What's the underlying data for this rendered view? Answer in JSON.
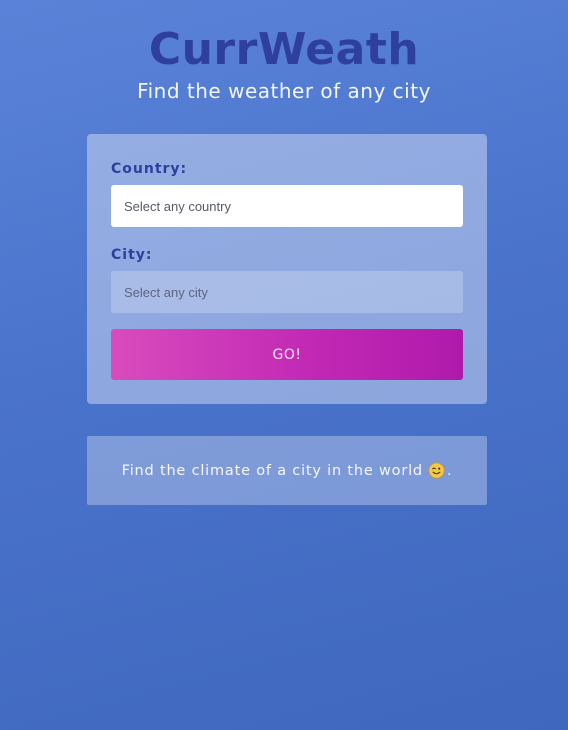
{
  "header": {
    "title": "CurrWeath",
    "subtitle": "Find the weather of any city"
  },
  "form": {
    "country_label": "Country:",
    "country_placeholder": "Select any country",
    "city_label": "City:",
    "city_placeholder": "Select any city",
    "submit_label": "GO!"
  },
  "info": {
    "message": "Find the climate of a city in the world",
    "emoji_icon": "winking-face-icon",
    "trailing": "."
  },
  "colors": {
    "background": "#4a73cc",
    "title": "#2f3f9e",
    "button_start": "#d94bbd",
    "button_end": "#b01aab"
  }
}
